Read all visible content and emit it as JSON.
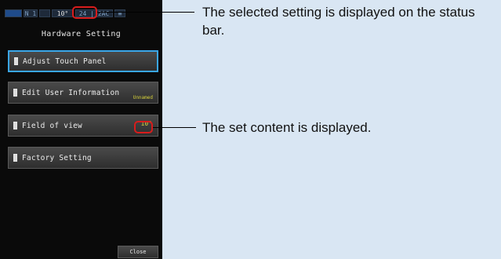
{
  "status_bar": {
    "mode": "N 1",
    "field_of_view": "10°",
    "date": "24 | 2AC",
    "sound": "≡"
  },
  "screen": {
    "title": "Hardware Setting",
    "menu": [
      {
        "label": "Adjust Touch Panel",
        "value": ""
      },
      {
        "label": "Edit User Information",
        "value": "Unnamed"
      },
      {
        "label": "Field of view",
        "value": "10°"
      },
      {
        "label": "Factory Setting",
        "value": ""
      }
    ],
    "close_label": "Close"
  },
  "callouts": {
    "status_bar": "The selected setting is displayed on the status bar.",
    "set_content": "The set content is displayed."
  },
  "colors": {
    "background": "#d9e6f3",
    "highlight": "#d81c1c",
    "selected_border": "#3aa6e8",
    "value_text": "#d6d13a"
  }
}
